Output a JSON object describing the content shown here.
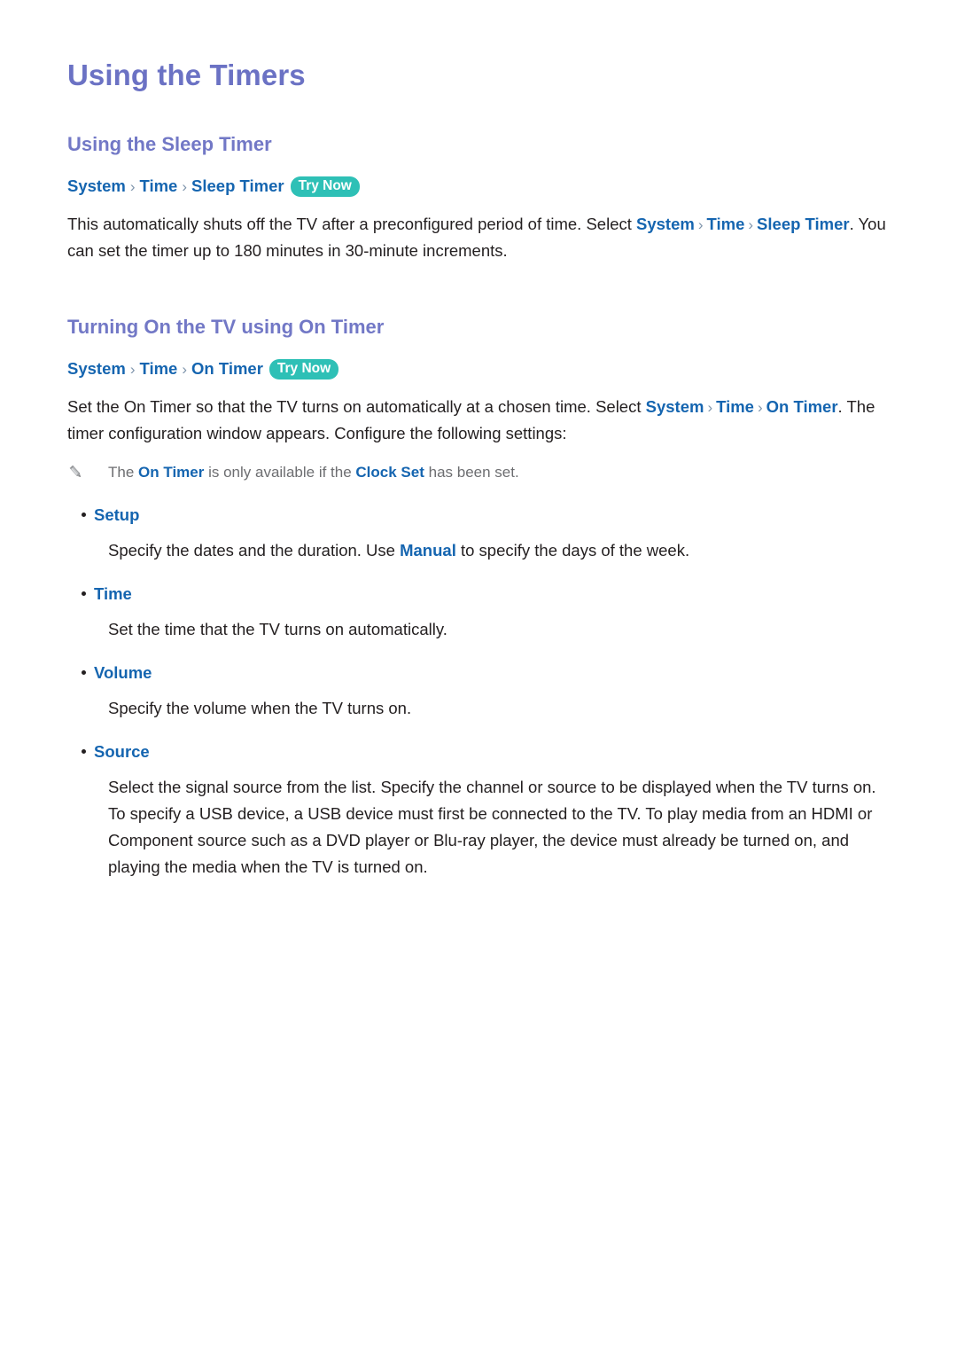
{
  "page": {
    "title": "Using the Timers"
  },
  "colors": {
    "title": "#6b72c4",
    "heading": "#7278c6",
    "link_blue": "#1565b0",
    "badge_teal": "#2ec0b6",
    "body_text": "#231f20",
    "note_text": "#6d6e71",
    "background": "#ffffff"
  },
  "sections": [
    {
      "heading": "Using the Sleep Timer",
      "breadcrumb": {
        "items": [
          "System",
          "Time",
          "Sleep Timer"
        ],
        "separator": "›",
        "badge": "Try Now"
      },
      "paragraph": {
        "part1": "This automatically shuts off the TV after a preconfigured period of time. Select ",
        "link1": "System",
        "sep1": "›",
        "link2": "Time",
        "sep2": "›",
        "link3": "Sleep Timer",
        "part2": ". You can set the timer up to 180 minutes in 30-minute increments."
      }
    },
    {
      "heading": "Turning On the TV using On Timer",
      "breadcrumb": {
        "items": [
          "System",
          "Time",
          "On Timer"
        ],
        "separator": "›",
        "badge": "Try Now"
      },
      "paragraph": {
        "part1": "Set the On Timer so that the TV turns on automatically at a chosen time. Select ",
        "link1": "System",
        "sep1": "›",
        "link2": "Time",
        "sep2": "›",
        "link3": "On Timer",
        "part2": ". The timer configuration window appears. Configure the following settings:"
      },
      "note": {
        "icon": "pencil-icon",
        "part1": "The ",
        "link1": "On Timer",
        "part2": " is only available if the ",
        "link2": "Clock Set",
        "part3": " has been set."
      },
      "bullets": [
        {
          "label": "Setup",
          "desc_part1": "Specify the dates and the duration. Use ",
          "desc_link": "Manual",
          "desc_part2": " to specify the days of the week."
        },
        {
          "label": "Time",
          "desc_part1": "Set the time that the TV turns on automatically.",
          "desc_link": "",
          "desc_part2": ""
        },
        {
          "label": "Volume",
          "desc_part1": "Specify the volume when the TV turns on.",
          "desc_link": "",
          "desc_part2": ""
        },
        {
          "label": "Source",
          "desc_part1": "Select the signal source from the list. Specify the channel or source to be displayed when the TV turns on. To specify a USB device, a USB device must first be connected to the TV. To play media from an HDMI or Component source such as a DVD player or Blu-ray player, the device must already be turned on, and playing the media when the TV is turned on.",
          "desc_link": "",
          "desc_part2": ""
        }
      ]
    }
  ]
}
